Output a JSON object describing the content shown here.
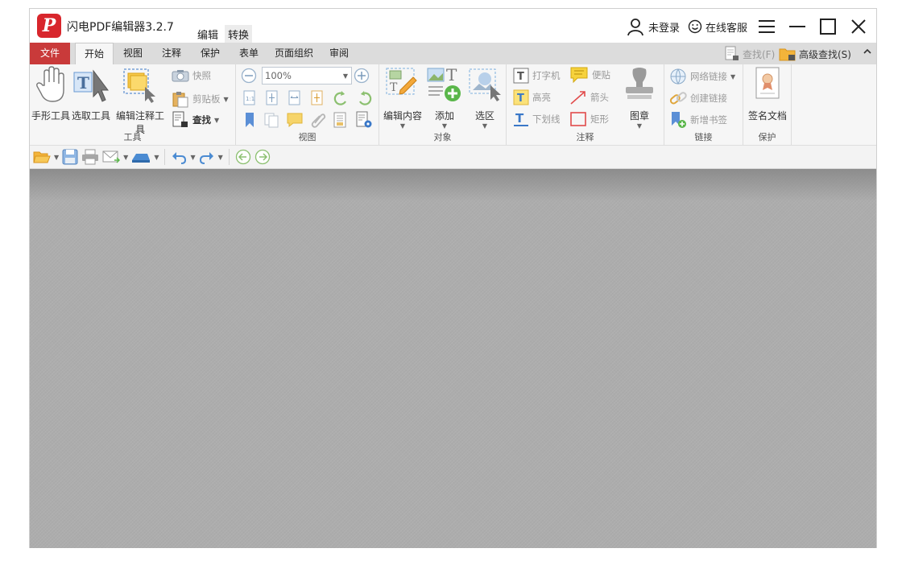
{
  "app": {
    "title": "闪电PDF编辑器3.2.7",
    "logo_letter": "P"
  },
  "top_menu": [
    {
      "label": "编辑"
    },
    {
      "label": "转换"
    }
  ],
  "title_right": {
    "login": "未登录",
    "support": "在线客服"
  },
  "tabs": [
    {
      "label": "文件"
    },
    {
      "label": "开始"
    },
    {
      "label": "视图"
    },
    {
      "label": "注释"
    },
    {
      "label": "保护"
    },
    {
      "label": "表单"
    },
    {
      "label": "页面组织"
    },
    {
      "label": "审阅"
    }
  ],
  "tab_right": {
    "find": "查找(F)",
    "advanced_find": "高级查找(S)"
  },
  "ribbon": {
    "tools": {
      "label": "工具",
      "hand": "手形工具",
      "select": "选取工具",
      "edit_annot": "编辑注释工具",
      "snapshot": "快照",
      "clipboard": "剪贴板",
      "find": "查找"
    },
    "view": {
      "label": "视图",
      "zoom": "100%"
    },
    "object": {
      "label": "对象",
      "edit_content": "编辑内容",
      "add": "添加",
      "select_area": "选区"
    },
    "annotation": {
      "label": "注释",
      "typewriter": "打字机",
      "sticky": "便贴",
      "highlight": "高亮",
      "arrow": "箭头",
      "underline": "下划线",
      "rect": "矩形",
      "stamp": "图章"
    },
    "links": {
      "label": "链接",
      "web_link": "网络链接",
      "create_link": "创建链接",
      "new_bookmark": "新增书签"
    },
    "protect": {
      "label": "保护",
      "sign": "签名文档"
    }
  },
  "colors": {
    "file_tab": "#c93a3a",
    "logo": "#d8262c",
    "accent_blue": "#3a78c8",
    "doc_bg": "#a9a9a9"
  }
}
